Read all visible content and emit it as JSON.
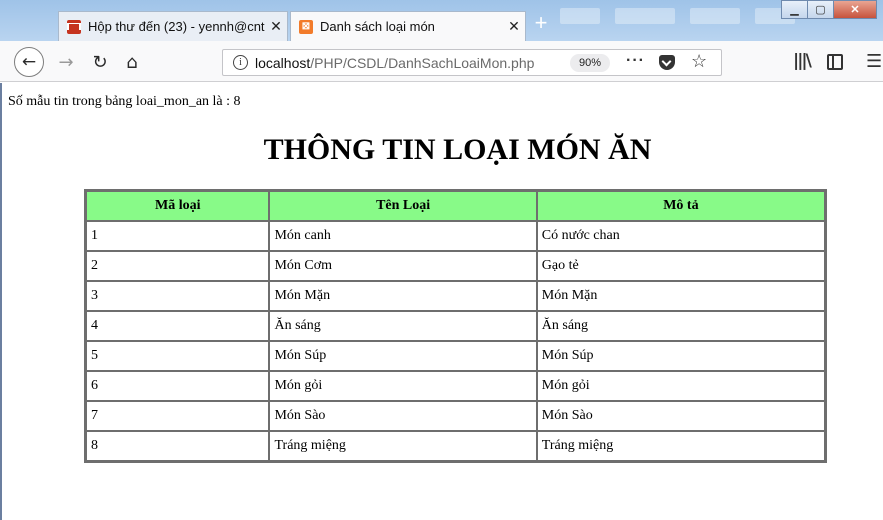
{
  "browser": {
    "tabs": [
      {
        "title": "Hộp thư đến (23) - yennh@cnt",
        "icon": "gmail-icon",
        "active": false
      },
      {
        "title": "Danh sách loại món",
        "icon": "xampp-icon",
        "active": true
      }
    ],
    "url_host": "localhost",
    "url_path": "/PHP/CSDL/DanhSachLoaiMon.php",
    "zoom": "90%"
  },
  "page": {
    "count_line": "Số mẫu tin trong bảng loai_mon_an là : 8",
    "title": "THÔNG TIN LOẠI MÓN ĂN",
    "table": {
      "headers": [
        "Mã loại",
        "Tên Loại",
        "Mô tả"
      ],
      "header_color": "#88fa88",
      "rows": [
        [
          "1",
          "Món canh",
          "Có nước chan"
        ],
        [
          "2",
          "Món Cơm",
          "Gạo tẻ"
        ],
        [
          "3",
          "Món Mặn",
          "Món Mặn"
        ],
        [
          "4",
          "Ăn sáng",
          "Ăn sáng"
        ],
        [
          "5",
          "Món Súp",
          "Món Súp"
        ],
        [
          "6",
          "Món gỏi",
          "Món gỏi"
        ],
        [
          "7",
          "Món Sào",
          "Món Sào"
        ],
        [
          "8",
          "Tráng miệng",
          "Tráng miệng"
        ]
      ]
    }
  }
}
